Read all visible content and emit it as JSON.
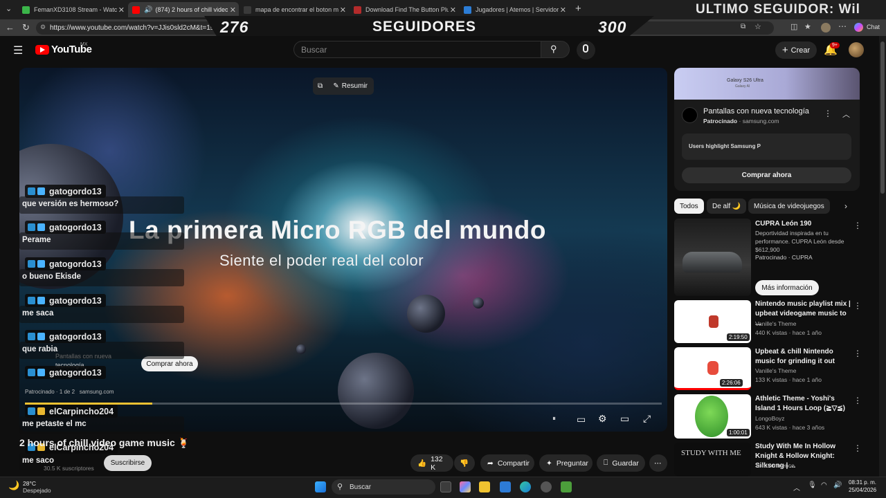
{
  "browser": {
    "tabs": [
      {
        "label": "FemanXD3108 Stream - Watch Li",
        "color": "#3bb54a"
      },
      {
        "label": "(874) 2 hours of chill video ga",
        "color": "#ff0000"
      },
      {
        "label": "mapa de encontrar el boton mine",
        "color": "#3a3a3a"
      },
      {
        "label": "Download Find The Button Plus 2",
        "color": "#b32b2b"
      },
      {
        "label": "Jugadores | Atemos | Servidor de",
        "color": "#2c7dd6"
      }
    ],
    "url": "https://www.youtube.com/watch?v=JJis0sld2cM&t=1s",
    "chat_label": "Chat"
  },
  "overlay": {
    "current_count": "276",
    "label": "SEGUIDORES",
    "goal_count": "300",
    "last_follower": "ULTIMO SEGUIDOR: Wil"
  },
  "youtube": {
    "logo_text": "YouTube",
    "country": "MX",
    "search_placeholder": "Buscar",
    "create_label": "Crear",
    "notification_count": "9+"
  },
  "video": {
    "headline": "La primera Micro RGB del mundo",
    "subline": "Siente el poder real del color",
    "summarize_label": "Resumir",
    "ad_card_title": "Pantallas con nueva tecnología",
    "ad_buy_label": "Comprar ahora",
    "ad_sponsor": "Patrocinado",
    "ad_position": "1 de 2",
    "ad_domain": "samsung.com"
  },
  "chat": [
    {
      "user": "gatogordo13",
      "message": "que versión es hermoso?",
      "badge": "blue"
    },
    {
      "user": "gatogordo13",
      "message": "Perame",
      "badge": "blue"
    },
    {
      "user": "gatogordo13",
      "message": "o bueno Ekisde",
      "badge": "blue"
    },
    {
      "user": "gatogordo13",
      "message": "me saca",
      "badge": "blue"
    },
    {
      "user": "gatogordo13",
      "message": "que rabia",
      "badge": "blue"
    },
    {
      "user": "gatogordo13",
      "message": "",
      "badge": "blue"
    },
    {
      "user": "elCarpincho204",
      "message": "me petaste el mc",
      "badge": "gold"
    },
    {
      "user": "elCarpincho204",
      "message": "me saco",
      "badge": "gold"
    }
  ],
  "below_video": {
    "title": "2 hours of chill video game music 🍹",
    "subscribe_label": "Suscribirse",
    "subscriber_count": "30.5 K suscriptores",
    "likes": "132 K",
    "share_label": "Compartir",
    "ask_label": "Preguntar",
    "save_label": "Guardar"
  },
  "sponsor": {
    "banner_title": "Galaxy S26 Ultra",
    "banner_sub": "Galaxy AI",
    "title": "Pantallas con nueva tecnología",
    "sponsored": "Patrocinado",
    "domain": "samsung.com",
    "highlight": "Users highlight Samsung P",
    "buy_label": "Comprar ahora"
  },
  "chips": [
    "Todos",
    "De alf 🌙",
    "Música de videojuegos"
  ],
  "recommendations": [
    {
      "title": "CUPRA León 190",
      "desc": "Deportividad inspirada en tu performance. CUPRA León desde $612,900",
      "channel": "Patrocinado · CUPRA",
      "cta": "Más información"
    },
    {
      "title": "Nintendo music playlist mix | upbeat videogame music to ...",
      "channel": "Vanille's Theme",
      "meta": "440 K vistas · hace 1 año",
      "duration": "2:19:50"
    },
    {
      "title": "Upbeat & chill Nintendo music for grinding it out",
      "channel": "Vanille's Theme",
      "meta": "133 K vistas · hace 1 año",
      "duration": "2:26:06"
    },
    {
      "title": "Athletic Theme - Yoshi's Island 1 Hours Loop (≧▽≦)",
      "channel": "LongoBoyz",
      "meta": "643 K vistas · hace 3 años",
      "duration": "1:00:01"
    },
    {
      "title": "Study With Me In Hollow Knight & Hollow Knight: Silksong | ...",
      "channel": "Yoru Ambience",
      "meta": "",
      "duration": "",
      "thumb_text": "STUDY WITH ME"
    }
  ],
  "taskbar": {
    "temperature": "28°C",
    "weather": "Despejado",
    "search_label": "Buscar",
    "time": "08:31 p. m.",
    "date": "25/04/2026"
  }
}
